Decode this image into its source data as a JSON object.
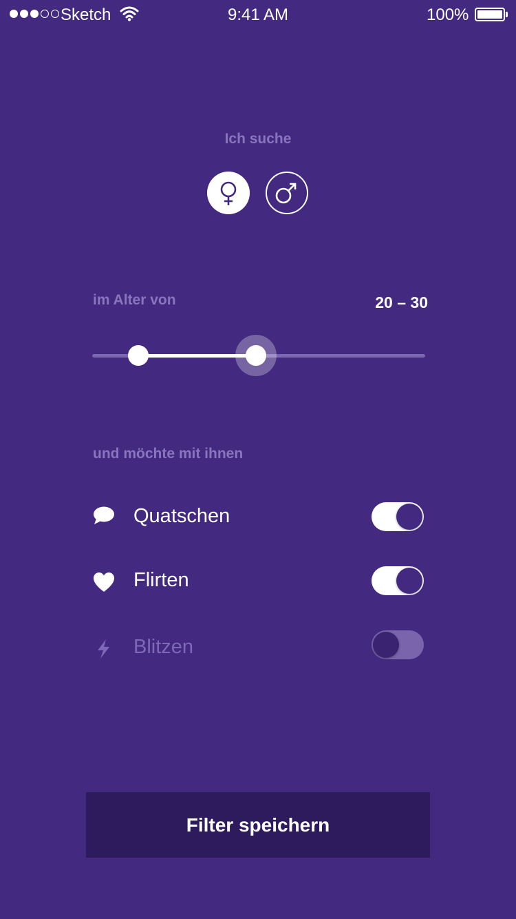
{
  "status_bar": {
    "carrier": "Sketch",
    "time": "9:41 AM",
    "battery": "100%"
  },
  "search": {
    "label": "Ich suche",
    "genders": [
      {
        "icon": "female-symbol-icon",
        "selected": true
      },
      {
        "icon": "male-symbol-icon",
        "selected": false
      }
    ]
  },
  "age": {
    "label": "im Alter von",
    "range_text": "20 – 30"
  },
  "activities": {
    "label": "und möchte mit ihnen",
    "items": [
      {
        "label": "Quatschen",
        "icon": "chat-bubble-icon",
        "enabled": true
      },
      {
        "label": "Flirten",
        "icon": "heart-icon",
        "enabled": true
      },
      {
        "label": "Blitzen",
        "icon": "lightning-icon",
        "enabled": false
      }
    ]
  },
  "save_button": {
    "label": "Filter speichern"
  },
  "colors": {
    "background": "#432a80",
    "button": "#2d1b5d",
    "muted_text": "#8a74bd"
  }
}
